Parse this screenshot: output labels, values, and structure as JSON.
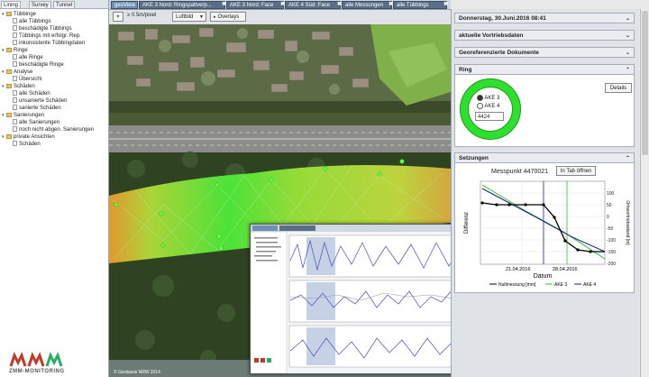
{
  "left_panel": {
    "tabs": [
      "Lining",
      "Survey",
      "Tunnel"
    ],
    "tree": [
      {
        "label": "Tübbinge",
        "level": 0
      },
      {
        "label": "alle Tübbings",
        "level": 1
      },
      {
        "label": "beschädigte Tübbings",
        "level": 1
      },
      {
        "label": "Tübbings mit erfolgr. Rep.",
        "level": 1
      },
      {
        "label": "inkonsistente Tübbingdaten",
        "level": 1
      },
      {
        "label": "Ringe",
        "level": 0
      },
      {
        "label": "alle Ringe",
        "level": 1
      },
      {
        "label": "beschädigte Ringe",
        "level": 1
      },
      {
        "label": "Analyse",
        "level": 0
      },
      {
        "label": "Übersicht",
        "level": 1
      },
      {
        "label": "Schäden",
        "level": 0
      },
      {
        "label": "alle Schäden",
        "level": 1
      },
      {
        "label": "unsanierte Schäden",
        "level": 1
      },
      {
        "label": "sanierte Schäden",
        "level": 1
      },
      {
        "label": "Sanierungen",
        "level": 0
      },
      {
        "label": "alle Sanierungen",
        "level": 1
      },
      {
        "label": "noch nicht abgen. Sanierungen",
        "level": 1
      },
      {
        "label": "private Ansichten",
        "level": 0
      },
      {
        "label": "Schäden",
        "level": 1
      }
    ],
    "logo_text": "ZMM-MONITORING"
  },
  "top_tabs": [
    {
      "label": "geoView",
      "closable": false,
      "active": true
    },
    {
      "label": "AKE 3 Nord: Ringspaltverp...",
      "closable": true,
      "active": false
    },
    {
      "label": "AKE 3 Nord: Face",
      "closable": true,
      "active": false
    },
    {
      "label": "AKE 4 Süd: Face",
      "closable": true,
      "active": false
    },
    {
      "label": "alle Messungen",
      "closable": true,
      "active": false
    },
    {
      "label": "alle Tübbings",
      "closable": true,
      "active": false
    }
  ],
  "map_toolbar": {
    "scale": "≥ 0.5m/pixel",
    "layer_select": "Luftbild",
    "overlays_label": "Overlays",
    "copyright": "© Geobasis NRW 2014"
  },
  "right_panel": {
    "sections": [
      {
        "title": "Donnerstag, 30.Juni.2016 08:41",
        "expanded": false
      },
      {
        "title": "aktuelle Vortriebsdaten",
        "expanded": false
      },
      {
        "title": "Georeferenzierte Dokumente",
        "expanded": false
      },
      {
        "title": "Ring",
        "expanded": true
      },
      {
        "title": "Setzungen",
        "expanded": true
      }
    ],
    "ring": {
      "options": [
        "AKE 3",
        "AKE 4"
      ],
      "selected": "AKE 3",
      "ring_number": "4424",
      "details_label": "Details"
    },
    "setzungen": {
      "messpunkt": "Messpunkt 4470021",
      "open_tab_label": "In Tab öffnen",
      "chart_data": {
        "type": "line",
        "xlabel": "Datum",
        "ylabel_left": "Differenz",
        "ylabel_right": "Ortsvortriebsstand [m]",
        "x_ticks": [
          "21.04.2016",
          "28.04.2016"
        ],
        "y_ticks_right": [
          100,
          50,
          0,
          -50,
          -100,
          -150,
          -200
        ],
        "series": [
          {
            "name": "Nullmessung [mm]",
            "color": "#000000"
          },
          {
            "name": "AKE 3",
            "color": "#2fbf2f"
          },
          {
            "name": "AKE 4",
            "color": "#1a237e"
          }
        ]
      }
    }
  },
  "colors": {
    "tab_active": "#6d8fb3",
    "tab_inactive": "#5a6f86",
    "ring_green": "#2ee02e",
    "heat_green": "#4ef03a",
    "heat_orange": "#f0a030"
  }
}
